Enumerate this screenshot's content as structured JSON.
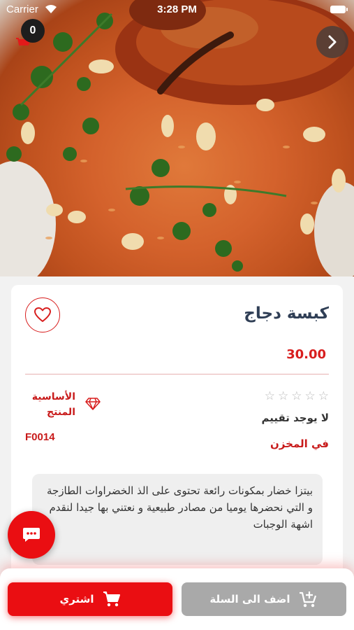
{
  "status_bar": {
    "carrier": "Carrier",
    "time": "3:28 PM"
  },
  "header": {
    "cart_count": "0"
  },
  "product": {
    "name": "كبسة دجاج",
    "price": "30.00",
    "rating_stars": 0,
    "rating_max": 5,
    "rating_text": "لا يوجد تقييم",
    "stock_status": "في المخزن",
    "category": "الأساسية المنتج",
    "code": "F0014",
    "description": "بيتزا خضار بمكونات رائعة تحتوى على الذ الخضراوات الطازجة و التي نحضرها يوميا من مصادر طبيعية و نعتني بها جيدا لنقدم اشهة الوجبات"
  },
  "actions": {
    "buy_label": "اشتري",
    "add_to_cart_label": "اضف الى السلة"
  },
  "colors": {
    "accent": "#ea0e12",
    "title": "#2f3e55",
    "disabled": "#a9a9a9"
  },
  "icons": [
    "wifi-icon",
    "battery-icon",
    "cart-icon",
    "chevron-right-icon",
    "heart-icon",
    "star-icon",
    "diamond-icon",
    "chat-icon",
    "add-cart-icon"
  ]
}
